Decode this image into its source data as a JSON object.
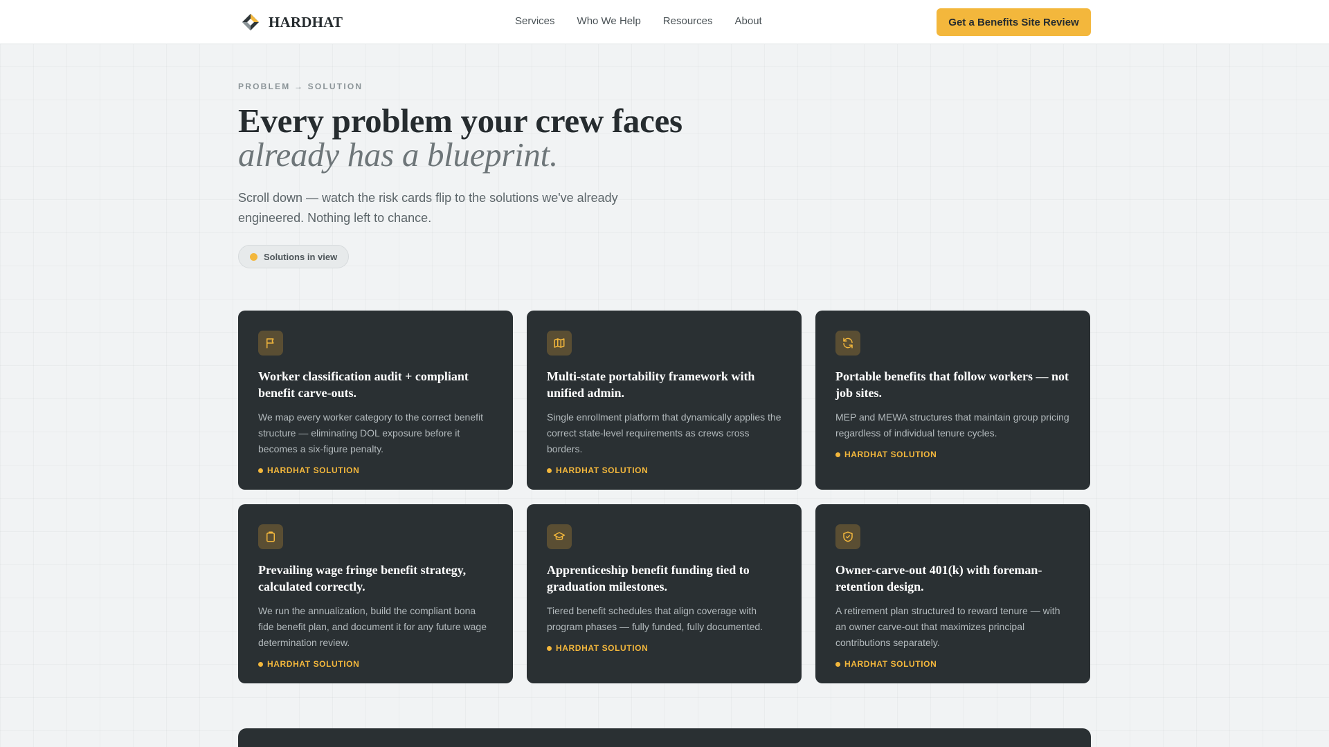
{
  "header": {
    "brand": "HARDHAT",
    "nav": [
      "Services",
      "Who We Help",
      "Resources",
      "About"
    ],
    "cta": "Get a Benefits Site Review"
  },
  "hero": {
    "eyebrow": "PROBLEM → SOLUTION",
    "title_line1": "Every problem your crew faces",
    "title_line2": "already has a blueprint.",
    "lede": "Scroll down — watch the risk cards flip to the solutions we've already engineered. Nothing left to chance.",
    "chip": "Solutions in view"
  },
  "cards": [
    {
      "icon": "flag-icon",
      "title": "Worker classification audit + compliant benefit carve-outs.",
      "body": "We map every worker category to the correct benefit structure — eliminating DOL exposure before it becomes a six-figure penalty.",
      "tag": "HARDHAT SOLUTION"
    },
    {
      "icon": "map-icon",
      "title": "Multi-state portability framework with unified admin.",
      "body": "Single enrollment platform that dynamically applies the correct state-level requirements as crews cross borders.",
      "tag": "HARDHAT SOLUTION"
    },
    {
      "icon": "refresh-icon",
      "title": "Portable benefits that follow workers — not job sites.",
      "body": "MEP and MEWA structures that maintain group pricing regardless of individual tenure cycles.",
      "tag": "HARDHAT SOLUTION"
    },
    {
      "icon": "clipboard-icon",
      "title": "Prevailing wage fringe benefit strategy, calculated correctly.",
      "body": "We run the annualization, build the compliant bona fide benefit plan, and document it for any future wage determination review.",
      "tag": "HARDHAT SOLUTION"
    },
    {
      "icon": "graduation-cap-icon",
      "title": "Apprenticeship benefit funding tied to graduation milestones.",
      "body": "Tiered benefit schedules that align coverage with program phases — fully funded, fully documented.",
      "tag": "HARDHAT SOLUTION"
    },
    {
      "icon": "shield-check-icon",
      "title": "Owner-carve-out 401(k) with foreman-retention design.",
      "body": "A retirement plan structured to reward tenure — with an owner carve-out that maximizes principal contributions separately.",
      "tag": "HARDHAT SOLUTION"
    }
  ],
  "colors": {
    "accent": "#f3b73c",
    "card_bg": "#2a3033",
    "page_bg": "#f1f3f4",
    "text_dark": "#262c2f"
  }
}
